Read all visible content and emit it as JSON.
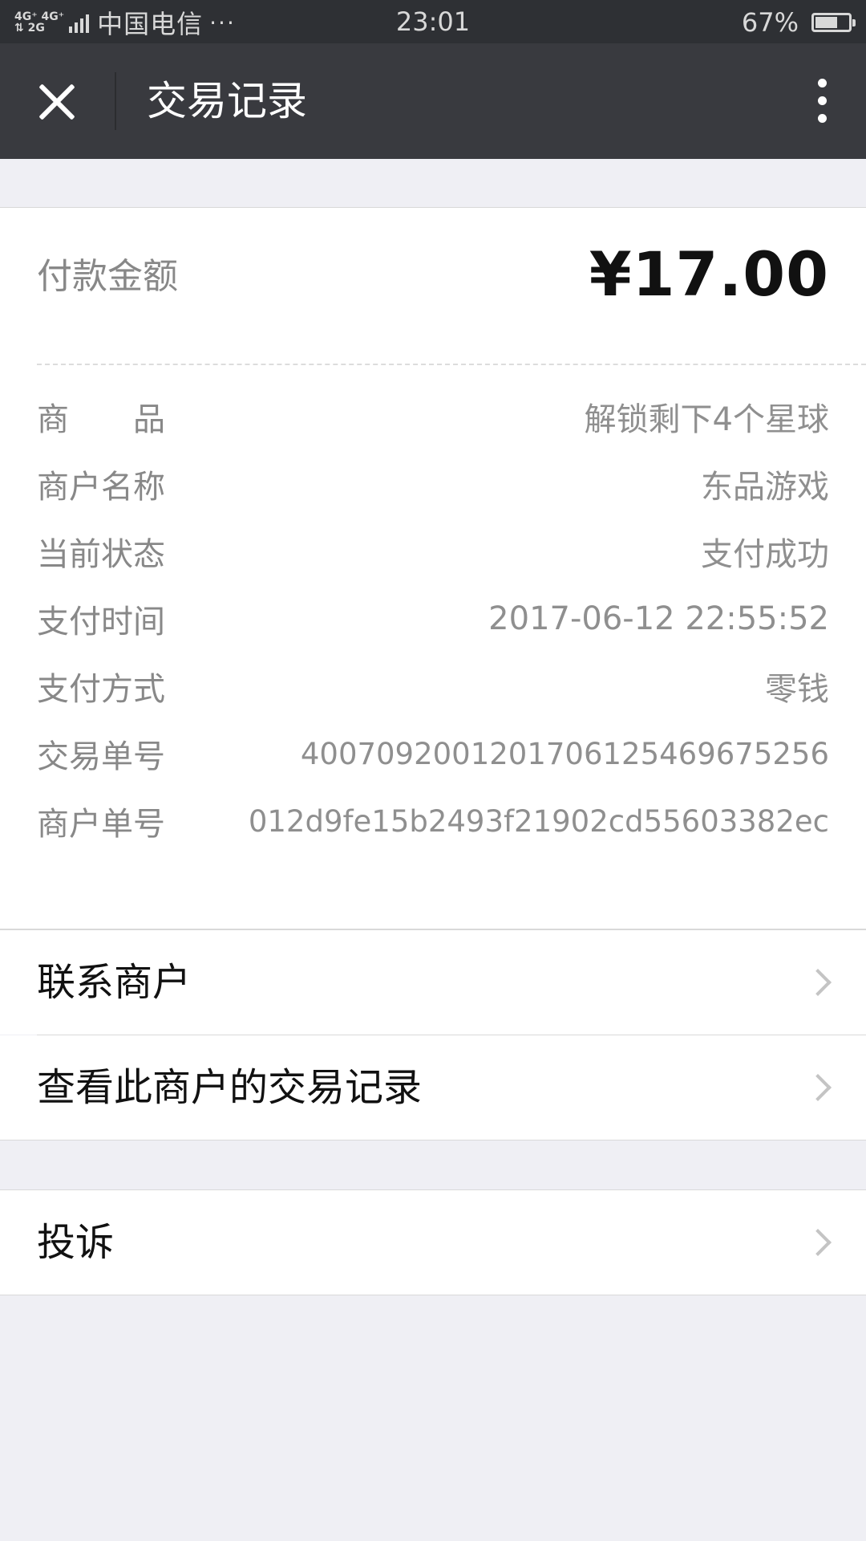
{
  "status_bar": {
    "network_top": "4G⁺ 4G⁺",
    "network_bottom": "⇅ 2G",
    "carrier": "中国电信",
    "carrier_extra": "···",
    "time": "23:01",
    "battery_percent": "67%",
    "battery_level": 0.67
  },
  "nav": {
    "close_icon": "close-icon",
    "title": "交易记录",
    "more_icon": "more-vertical-icon"
  },
  "payment": {
    "amount_label": "付款金额",
    "amount": "¥17.00"
  },
  "details": [
    {
      "key": "商　　品",
      "value": "解锁剩下4个星球"
    },
    {
      "key": "商户名称",
      "value": "东品游戏"
    },
    {
      "key": "当前状态",
      "value": "支付成功"
    },
    {
      "key": "支付时间",
      "value": "2017-06-12 22:55:52"
    },
    {
      "key": "支付方式",
      "value": "零钱"
    },
    {
      "key": "交易单号",
      "value": "4007092001201706125469675256"
    },
    {
      "key": "商户单号",
      "value": "012d9fe15b2493f21902cd55603382ec"
    }
  ],
  "actions": {
    "contact_merchant": "联系商户",
    "view_merchant_records": "查看此商户的交易记录",
    "complain": "投诉"
  },
  "colors": {
    "status_bar_bg": "#2e3034",
    "nav_bg": "#393a3f",
    "page_bg": "#efeff4",
    "card_bg": "#ffffff"
  }
}
